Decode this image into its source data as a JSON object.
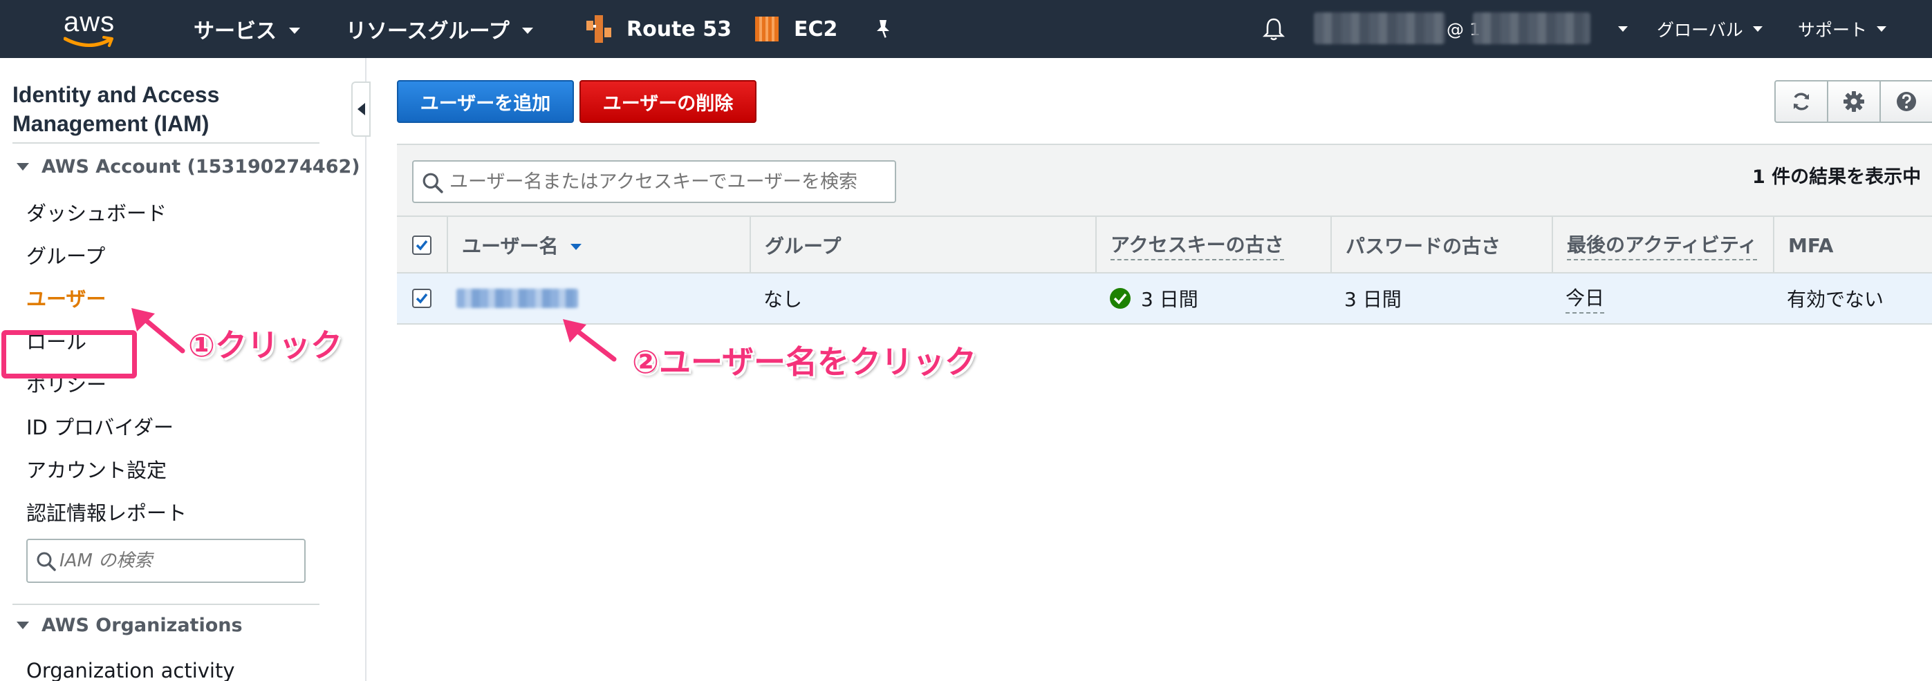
{
  "topbar": {
    "logo_text": "aws",
    "services_label": "サービス",
    "resource_groups_label": "リソースグループ",
    "route53_label": "Route 53",
    "ec2_label": "EC2",
    "account_at": "@ 1",
    "region_label": "グローバル",
    "support_label": "サポート",
    "icons": [
      "bell-icon",
      "pin-icon",
      "route53-icon",
      "ec2-icon"
    ]
  },
  "sidebar": {
    "title": "Identity and Access Management (IAM)",
    "account_section": "AWS Account (153190274462)",
    "items": [
      {
        "label": "ダッシュボード"
      },
      {
        "label": "グループ"
      },
      {
        "label": "ユーザー",
        "active": true
      },
      {
        "label": "ロール"
      },
      {
        "label": "ポリシー"
      },
      {
        "label": "ID プロバイダー"
      },
      {
        "label": "アカウント設定"
      },
      {
        "label": "認証情報レポート"
      }
    ],
    "search_placeholder": "IAM の検索",
    "org_section": "AWS Organizations",
    "org_items": [
      {
        "label": "Organization activity"
      }
    ]
  },
  "toolbar": {
    "add_user_label": "ユーザーを追加",
    "delete_user_label": "ユーザーの削除",
    "icons": [
      "refresh-icon",
      "gear-icon",
      "help-icon"
    ]
  },
  "table": {
    "search_placeholder": "ユーザー名またはアクセスキーでユーザーを検索",
    "result_count": "1 件の結果を表示中",
    "columns": [
      "ユーザー名",
      "グループ",
      "アクセスキーの古さ",
      "パスワードの古さ",
      "最後のアクティビティ",
      "MFA"
    ],
    "rows": [
      {
        "selected": true,
        "username": "",
        "groups": "なし",
        "access_key_age": "3 日間",
        "password_age": "3 日間",
        "last_activity": "今日",
        "mfa": "有効でない"
      }
    ]
  },
  "annotations": {
    "step1": "①クリック",
    "step2": "②ユーザー名をクリック"
  },
  "colors": {
    "topbar_bg": "#232f3e",
    "primary_button": "#1468c2",
    "danger_button": "#c40000",
    "active_nav": "#e07a00",
    "annotation": "#f4327a",
    "status_ok": "#1d8102"
  }
}
